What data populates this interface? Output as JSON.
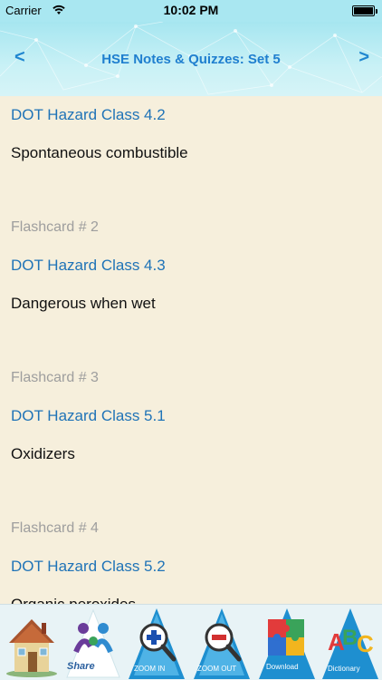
{
  "status": {
    "carrier": "Carrier",
    "time": "10:02 PM"
  },
  "nav": {
    "title": "HSE Notes & Quizzes: Set 5",
    "back_label": "<",
    "forward_label": ">"
  },
  "cards": [
    {
      "label": "",
      "front": "DOT Hazard Class 4.2",
      "back": "Spontaneous combustible"
    },
    {
      "label": "Flashcard # 2",
      "front": "DOT Hazard Class 4.3",
      "back": "Dangerous when wet"
    },
    {
      "label": "Flashcard # 3",
      "front": "DOT Hazard Class 5.1",
      "back": "Oxidizers"
    },
    {
      "label": "Flashcard # 4",
      "front": "DOT Hazard Class 5.2",
      "back": "Organic peroxides"
    }
  ],
  "tabbar": {
    "share_label": "Share",
    "zoom_in_label": "ZOOM IN",
    "zoom_out_label": "ZOOM OUT",
    "puzzle_label": "Download",
    "abc_label": "Dictionary"
  },
  "colors": {
    "accent": "#1f86d0",
    "link": "#1f73b7",
    "muted": "#9e9e9e",
    "background": "#f6efdc",
    "header": "#a9e7f1"
  }
}
